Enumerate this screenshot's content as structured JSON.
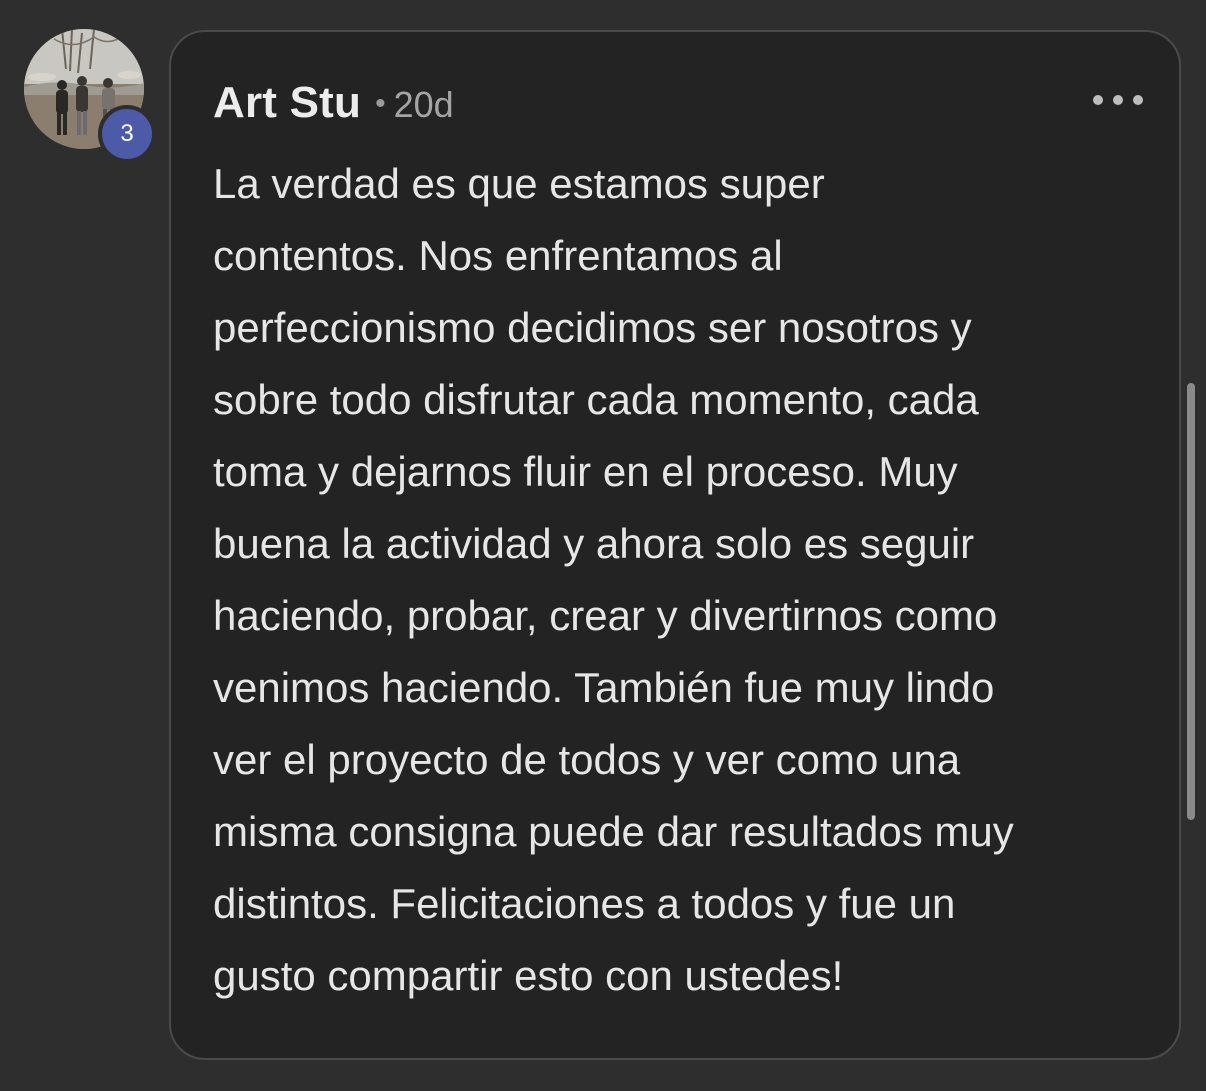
{
  "comment": {
    "author": {
      "name": "Art Stu",
      "avatar_icon": "avatar-photo",
      "level_badge": "3"
    },
    "meta_separator": "•",
    "timestamp": "20d",
    "more_icon": "more-horizontal-icon",
    "body": "La verdad es que estamos super\ncontentos. Nos enfrentamos al\nperfeccionismo decidimos ser nosotros y\nsobre todo disfrutar cada momento, cada\ntoma y dejarnos fluir en el proceso. Muy\nbuena la actividad y ahora solo es seguir\nhaciendo, probar, crear y divertirnos como\nvenimos haciendo. También fue muy lindo\nver el proyecto de todos y ver como una\nmisma consigna puede dar resultados muy\ndistintos. Felicitaciones a todos y fue un\ngusto compartir esto con ustedes!"
  },
  "colors": {
    "page_background": "#2e2e2e",
    "card_background": "#232323",
    "card_border": "#4a4a4a",
    "badge_background": "#4c5aa8",
    "text_primary": "#e6e6e6",
    "text_muted": "#a4a4a4"
  }
}
